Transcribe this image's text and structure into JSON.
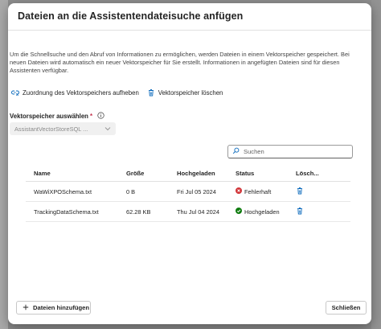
{
  "dialog": {
    "title": "Dateien an die Assistentendateisuche anfügen",
    "description": "Um die Schnellsuche und den Abruf von Informationen zu ermöglichen, werden Dateien in einem Vektorspeicher gespeichert. Bei neuen Dateien wird automatisch ein neuer Vektorspeicher für Sie erstellt. Informationen in angefügten Dateien sind für diesen Assistenten verfügbar."
  },
  "actions": {
    "unassign_label": "Zuordnung des Vektorspeichers aufheben",
    "delete_label": "Vektorspeicher löschen"
  },
  "vector_store": {
    "label": "Vektorspeicher auswählen",
    "required_marker": "*",
    "selected_value": "AssistantVectorStoreSQL ..."
  },
  "search": {
    "placeholder": "Suchen"
  },
  "table": {
    "headers": [
      "Name",
      "Größe",
      "Hochgeladen",
      "Status",
      "Lösch..."
    ],
    "rows": [
      {
        "name": "WaWiXPOSchema.txt",
        "size": "0 B",
        "uploaded": "Fri Jul 05 2024",
        "status": "Fehlerhaft",
        "status_kind": "error"
      },
      {
        "name": "TrackingDataSchema.txt",
        "size": "62.28 KB",
        "uploaded": "Thu Jul 04 2024",
        "status": "Hochgeladen",
        "status_kind": "success"
      }
    ]
  },
  "footer": {
    "add_files_label": "Dateien hinzufügen",
    "close_label": "Schließen"
  },
  "colors": {
    "accent": "#0f6cbd",
    "error": "#d13438",
    "success": "#107c10",
    "required": "#c4314b"
  },
  "icons": {
    "unassign": "link-dismiss-icon",
    "delete_store": "trash-icon",
    "info": "info-icon",
    "search": "search-icon",
    "row_delete": "trash-icon",
    "add": "plus-icon"
  }
}
